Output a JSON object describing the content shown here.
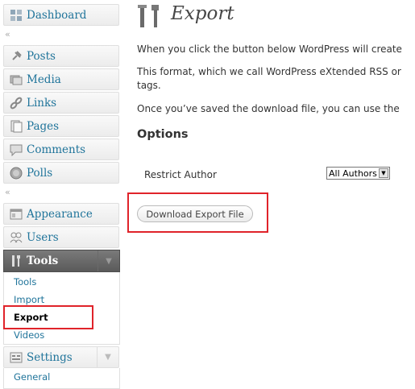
{
  "sidebar": {
    "dashboard": "Dashboard",
    "posts": "Posts",
    "media": "Media",
    "links": "Links",
    "pages": "Pages",
    "comments": "Comments",
    "polls": "Polls",
    "appearance": "Appearance",
    "users": "Users",
    "tools": "Tools",
    "tools_sub": [
      "Tools",
      "Import",
      "Export",
      "Videos"
    ],
    "settings": "Settings",
    "settings_sub": [
      "General"
    ]
  },
  "main": {
    "title": "Export",
    "p1": "When you click the button below WordPress will create",
    "p2a": "This format, which we call WordPress eXtended RSS or",
    "p2b": "tags.",
    "p3": "Once you’ve saved the download file, you can use the",
    "options_heading": "Options",
    "restrict_label": "Restrict Author",
    "restrict_value": "All Authors",
    "download_button": "Download Export File"
  },
  "colors": {
    "link": "#21759b",
    "highlight": "#e0232a",
    "tools_header": "#5a5a5a"
  }
}
